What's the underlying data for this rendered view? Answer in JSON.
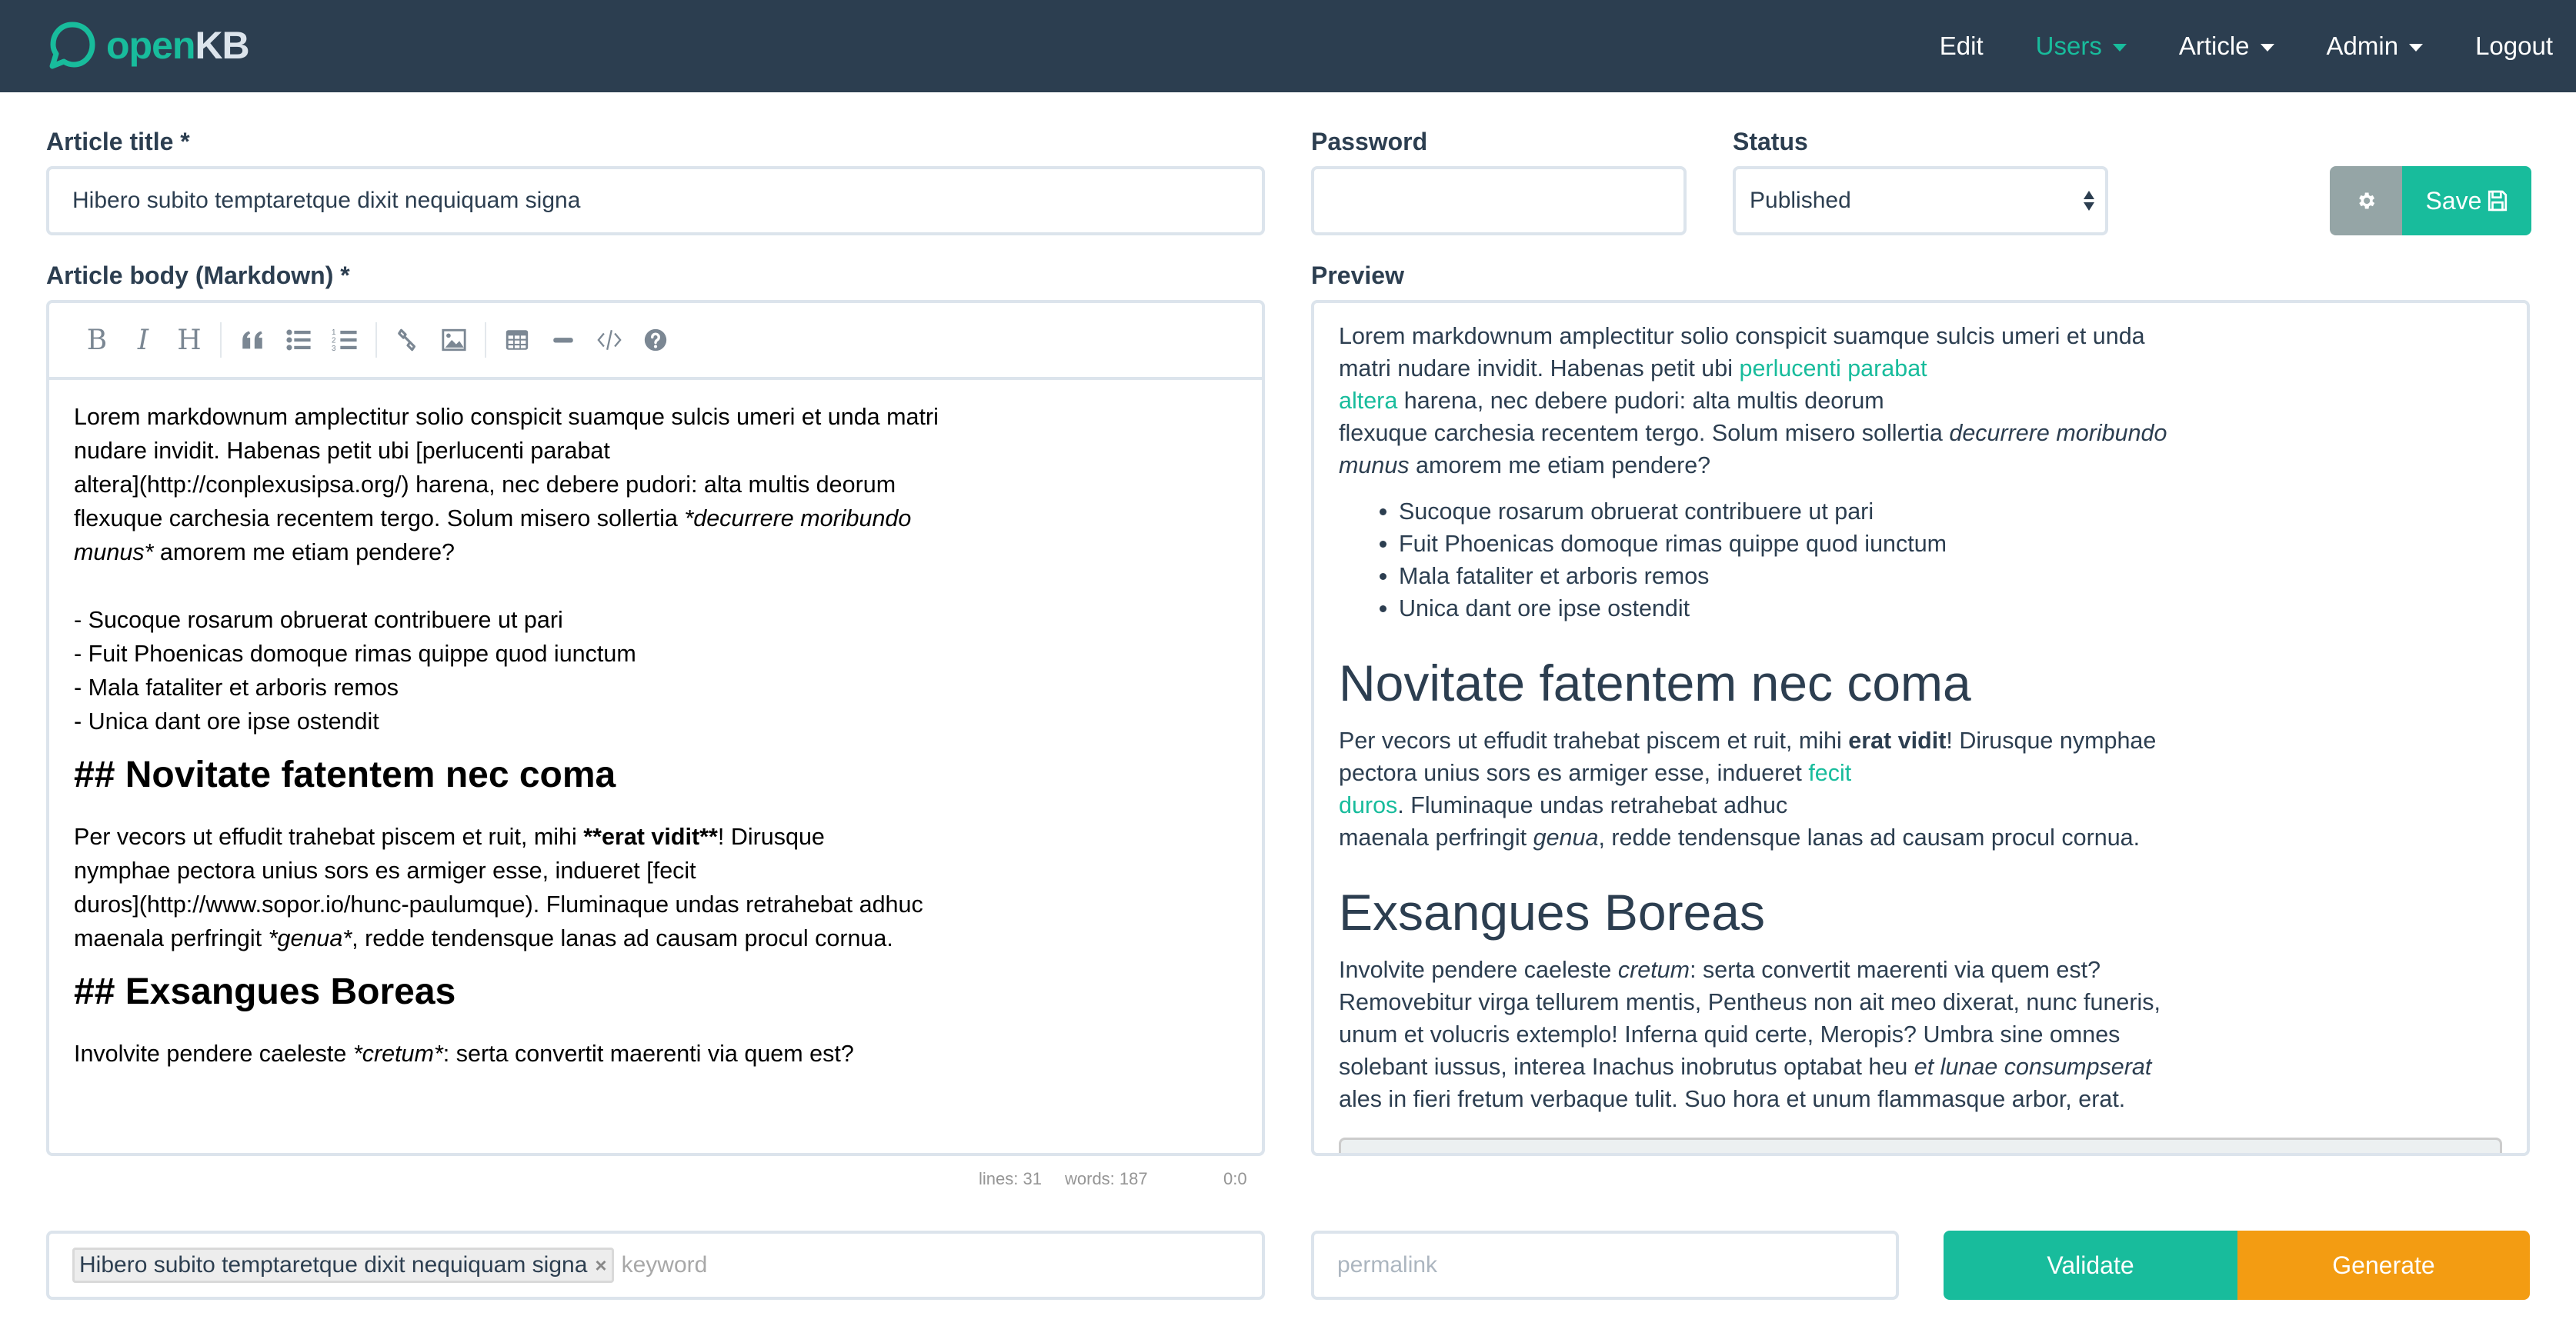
{
  "navbar": {
    "brand_prefix": "open",
    "brand_suffix": "KB",
    "items": [
      {
        "label": "Edit",
        "dropdown": false,
        "active": false
      },
      {
        "label": "Users",
        "dropdown": true,
        "active": true
      },
      {
        "label": "Article",
        "dropdown": true,
        "active": false
      },
      {
        "label": "Admin",
        "dropdown": true,
        "active": false
      },
      {
        "label": "Logout",
        "dropdown": false,
        "active": false
      }
    ]
  },
  "colors": {
    "navbar_bg": "#2c3e50",
    "accent": "#18bc9c",
    "secondary": "#95a5a6",
    "warning": "#f39c12",
    "border": "#dce4ec"
  },
  "form": {
    "title_label": "Article title *",
    "title_value": "Hibero subito temptaretque dixit nequiquam signa",
    "password_label": "Password",
    "password_value": "",
    "status_label": "Status",
    "status_value": "Published",
    "save_label": "Save",
    "body_label": "Article body (Markdown) *",
    "preview_label": "Preview"
  },
  "toolbar": {
    "buttons": [
      "bold-icon",
      "italic-icon",
      "heading-icon",
      "quote-icon",
      "unordered-list-icon",
      "ordered-list-icon",
      "link-icon",
      "image-icon",
      "table-icon",
      "horizontal-rule-icon",
      "code-icon",
      "help-icon"
    ],
    "bold": "B",
    "italic": "I",
    "heading": "H"
  },
  "editor": {
    "p1": [
      "Lorem markdownum amplectitur solio conspicit suamque sulcis umeri et unda matri",
      "nudare invidit. Habenas petit ubi [perlucenti parabat",
      "altera](http://conplexusipsa.org/) harena, nec debere pudori: alta multis deorum",
      "flexuque carchesia recentem tergo. Solum misero sollertia ",
      "*decurrere moribundo",
      "munus*",
      " amorem me etiam pendere?"
    ],
    "list": [
      "- Sucoque rosarum obruerat contribuere ut pari",
      "- Fuit Phoenicas domoque rimas quippe quod iunctum",
      "- Mala fataliter et arboris remos",
      "- Unica dant ore ipse ostendit"
    ],
    "h2_1": "## Novitate fatentem nec coma",
    "p2": {
      "l1a": "Per vecors ut effudit trahebat piscem et ruit, mihi ",
      "l1b": "**erat vidit**",
      "l1c": "! Dirusque",
      "l2": "nymphae pectora unius sors es armiger esse, indueret [fecit",
      "l3": "duros](http://www.sopor.io/hunc-paulumque). Fluminaque undas retrahebat adhuc",
      "l4a": "maenala perfringit ",
      "l4b": "*genua*",
      "l4c": ", redde tendensque lanas ad causam procul cornua."
    },
    "h2_2": "## Exsangues Boreas",
    "p3_a": "Involvite pendere caeleste ",
    "p3_b": "*cretum*",
    "p3_c": ": serta convertit maerenti via quem est?"
  },
  "status_bar": {
    "lines": "lines: 31",
    "words": "words: 187",
    "cursor": "0:0"
  },
  "preview": {
    "p1": {
      "a": "Lorem markdownum amplectitur solio conspicit suamque sulcis umeri et unda matri nudare invidit. Habenas petit ubi ",
      "link1": "perlucenti parabat",
      "link2": "altera",
      "b": " harena, nec debere pudori: alta multis deorum",
      "c": "flexuque carchesia recentem tergo. Solum misero sollertia ",
      "em": "decurrere moribundo munus",
      "d": " amorem me etiam pendere?"
    },
    "list": [
      "Sucoque rosarum obruerat contribuere ut pari",
      "Fuit Phoenicas domoque rimas quippe quod iunctum",
      "Mala fataliter et arboris remos",
      "Unica dant ore ipse ostendit"
    ],
    "h2_1": "Novitate fatentem nec coma",
    "p2": {
      "a": "Per vecors ut effudit trahebat piscem et ruit, mihi ",
      "bold": "erat vidit",
      "b": "! Dirusque nymphae pectora unius sors es armiger esse, indueret ",
      "link1": "fecit",
      "link2": "duros",
      "c": ". Fluminaque undas retrahebat adhuc",
      "d": "maenala perfringit ",
      "em": "genua",
      "e": ", redde tendensque lanas ad causam procul cornua."
    },
    "h2_2": "Exsangues Boreas",
    "p3": {
      "a": "Involvite pendere caeleste ",
      "em1": "cretum",
      "b": ": serta convertit maerenti via quem est? Removebitur virga tellurem mentis, Pentheus non ait meo dixerat, nunc funeris, unum et volucris extemplo! Inferna quid certe, Meropis? Umbra sine omnes solebant iussus, interea Inachus inobrutus optabat heu ",
      "em2": "et lunae consumpserat",
      "c": "ales in fieri fretum verbaque tulit. Suo hora et unum flammasque arbor, erat."
    }
  },
  "keywords": {
    "tags": [
      "Hibero subito temptaretque dixit nequiquam signa"
    ],
    "placeholder": "keyword"
  },
  "permalink": {
    "placeholder": "permalink",
    "value": ""
  },
  "actions": {
    "validate_label": "Validate",
    "generate_label": "Generate"
  }
}
